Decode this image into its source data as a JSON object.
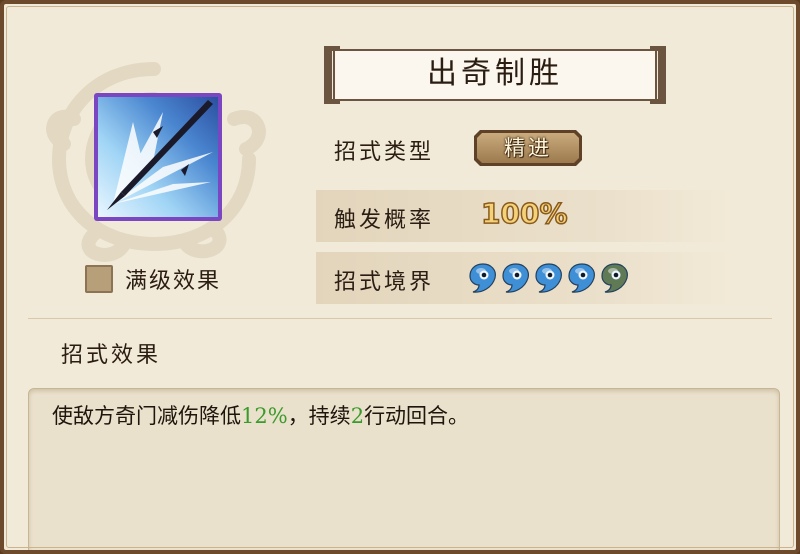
{
  "skill": {
    "name": "出奇制胜",
    "icon": "spear-thrust-icon",
    "full_effect_label": "满级效果",
    "type_label": "招式类型",
    "type_value": "精进",
    "rate_label": "触发概率",
    "rate_value": "100%",
    "realm_label": "招式境界",
    "realm_level": 4,
    "realm_max": 5
  },
  "effect": {
    "label": "招式效果",
    "desc_part1": "使敌方奇门减伤降低",
    "desc_value1": "12%",
    "desc_part2": "，持续",
    "desc_value2": "2",
    "desc_part3": "行动回合。"
  },
  "colors": {
    "panel_bg": "#f2ead8",
    "frame": "#6d4a2c",
    "highlight_green": "#3a9a2c",
    "icon_border": "#8e5bd0",
    "drop_active": "#3f8fd6",
    "drop_inactive": "#5f7a55"
  }
}
